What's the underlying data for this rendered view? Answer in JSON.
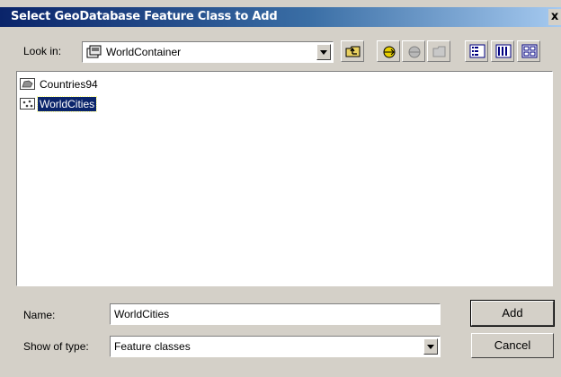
{
  "window": {
    "title": "Select GeoDatabase Feature Class to Add",
    "close_glyph": "x"
  },
  "look_in": {
    "label": "Look in:",
    "value": "WorldContainer",
    "icon": "container-icon"
  },
  "toolbar": {
    "buttons": [
      {
        "name": "up-one-level-icon"
      },
      {
        "name": "connect-folder-icon"
      },
      {
        "name": "disconnect-folder-icon"
      },
      {
        "name": "new-folder-icon"
      },
      {
        "name": "list-view-icon"
      },
      {
        "name": "details-view-icon"
      },
      {
        "name": "thumbnails-view-icon"
      }
    ]
  },
  "files": [
    {
      "name": "Countries94",
      "icon": "polygon-feature-class-icon",
      "selected": false
    },
    {
      "name": "WorldCities",
      "icon": "point-feature-class-icon",
      "selected": true
    }
  ],
  "name_field": {
    "label": "Name:",
    "value": "WorldCities"
  },
  "type_field": {
    "label": "Show of type:",
    "value": "Feature classes"
  },
  "buttons": {
    "add": "Add",
    "cancel": "Cancel"
  },
  "colors": {
    "title_bar": "#0a246a",
    "selection": "#0a246a",
    "face": "#d4d0c8"
  }
}
